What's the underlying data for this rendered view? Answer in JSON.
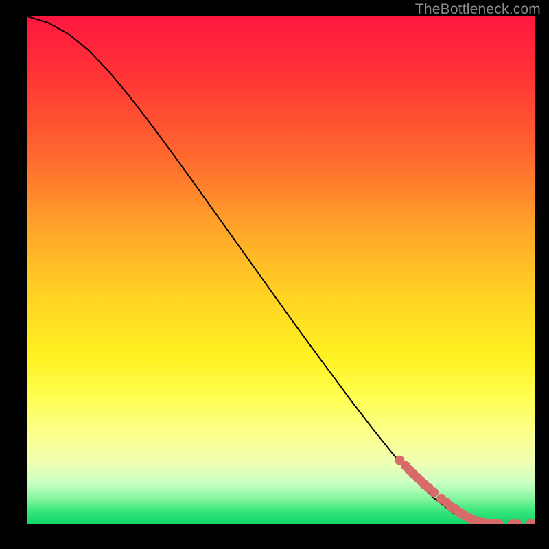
{
  "watermark": "TheBottleneck.com",
  "chart_data": {
    "type": "line",
    "title": "",
    "xlabel": "",
    "ylabel": "",
    "xlim": [
      0,
      100
    ],
    "ylim": [
      0,
      100
    ],
    "curve": {
      "name": "curve",
      "x": [
        0,
        4,
        8,
        12,
        16,
        20,
        24,
        28,
        32,
        36,
        40,
        44,
        48,
        52,
        56,
        60,
        64,
        68,
        72,
        76,
        80,
        84,
        86,
        88,
        90,
        92,
        94,
        96,
        98,
        100
      ],
      "y": [
        100,
        98.8,
        96.6,
        93.4,
        89.2,
        84.4,
        79.2,
        73.8,
        68.3,
        62.7,
        57.1,
        51.5,
        45.9,
        40.3,
        34.8,
        29.4,
        24.0,
        18.8,
        13.8,
        9.2,
        5.2,
        2.1,
        1.1,
        0.45,
        0.12,
        0.02,
        0.0,
        0.0,
        0.0,
        0.0
      ]
    },
    "marker_series": {
      "name": "highlighted-points",
      "color": "#d96a6a",
      "points": [
        {
          "x": 73.3,
          "y": 12.6
        },
        {
          "x": 74.5,
          "y": 11.5
        },
        {
          "x": 75.2,
          "y": 10.7
        },
        {
          "x": 76.0,
          "y": 9.9
        },
        {
          "x": 76.8,
          "y": 9.2
        },
        {
          "x": 77.5,
          "y": 8.5
        },
        {
          "x": 78.2,
          "y": 7.8
        },
        {
          "x": 79.0,
          "y": 7.2
        },
        {
          "x": 80.0,
          "y": 6.3
        },
        {
          "x": 81.5,
          "y": 5.0
        },
        {
          "x": 82.5,
          "y": 4.3
        },
        {
          "x": 83.3,
          "y": 3.6
        },
        {
          "x": 84.0,
          "y": 3.1
        },
        {
          "x": 84.7,
          "y": 2.6
        },
        {
          "x": 85.4,
          "y": 2.1
        },
        {
          "x": 86.1,
          "y": 1.7
        },
        {
          "x": 86.8,
          "y": 1.3
        },
        {
          "x": 87.5,
          "y": 1.0
        },
        {
          "x": 88.2,
          "y": 0.7
        },
        {
          "x": 89.2,
          "y": 0.4
        },
        {
          "x": 90.2,
          "y": 0.2
        },
        {
          "x": 91.5,
          "y": 0.1
        },
        {
          "x": 92.8,
          "y": 0.05
        },
        {
          "x": 95.4,
          "y": 0.0
        },
        {
          "x": 96.5,
          "y": 0.0
        },
        {
          "x": 99.0,
          "y": 0.0
        },
        {
          "x": 100.0,
          "y": 0.0
        }
      ]
    }
  }
}
